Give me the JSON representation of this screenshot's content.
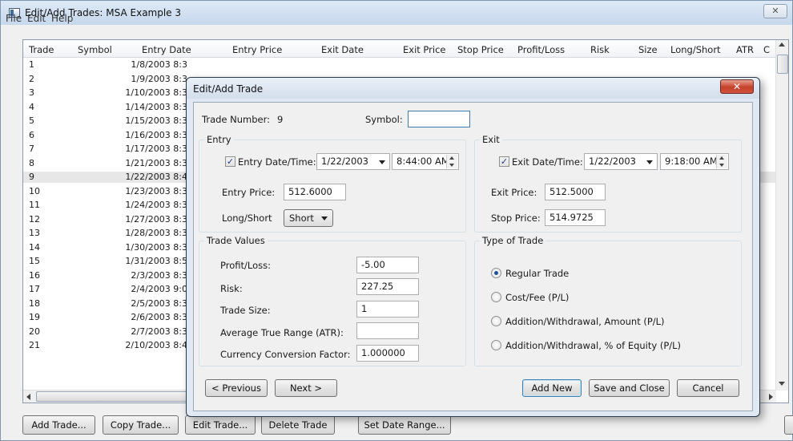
{
  "window": {
    "title": "Edit/Add Trades: MSA Example 3",
    "close_label": "✕"
  },
  "menu": [
    "File",
    "Edit",
    "Help"
  ],
  "table": {
    "columns": [
      "Trade",
      "Symbol",
      "Entry Date",
      "Entry Price",
      "Exit Date",
      "Exit Price",
      "Stop Price",
      "Profit/Loss",
      "Risk",
      "Size",
      "Long/Short",
      "ATR",
      "C"
    ],
    "rows": [
      {
        "trade": "1",
        "entry_date": "1/8/2003 8:3"
      },
      {
        "trade": "2",
        "entry_date": "1/9/2003 8:3"
      },
      {
        "trade": "3",
        "entry_date": "1/10/2003 8:3"
      },
      {
        "trade": "4",
        "entry_date": "1/14/2003 8:3"
      },
      {
        "trade": "5",
        "entry_date": "1/15/2003 8:3"
      },
      {
        "trade": "6",
        "entry_date": "1/16/2003 8:3"
      },
      {
        "trade": "7",
        "entry_date": "1/17/2003 8:3"
      },
      {
        "trade": "8",
        "entry_date": "1/21/2003 8:3"
      },
      {
        "trade": "9",
        "entry_date": "1/22/2003 8:4"
      },
      {
        "trade": "10",
        "entry_date": "1/23/2003 8:3"
      },
      {
        "trade": "11",
        "entry_date": "1/24/2003 8:3"
      },
      {
        "trade": "12",
        "entry_date": "1/27/2003 8:3"
      },
      {
        "trade": "13",
        "entry_date": "1/28/2003 8:3"
      },
      {
        "trade": "14",
        "entry_date": "1/30/2003 8:3"
      },
      {
        "trade": "15",
        "entry_date": "1/31/2003 8:5"
      },
      {
        "trade": "16",
        "entry_date": "2/3/2003 8:3"
      },
      {
        "trade": "17",
        "entry_date": "2/4/2003 9:0"
      },
      {
        "trade": "18",
        "entry_date": "2/5/2003 8:3"
      },
      {
        "trade": "19",
        "entry_date": "2/6/2003 8:3"
      },
      {
        "trade": "20",
        "entry_date": "2/7/2003 8:3"
      },
      {
        "trade": "21",
        "entry_date": "2/10/2003 8:4"
      }
    ],
    "selected_row": "9"
  },
  "bottom_buttons": [
    "Add Trade...",
    "Copy Trade...",
    "Edit Trade...",
    "Delete Trade",
    "Set Date Range..."
  ],
  "dialog": {
    "title": "Edit/Add Trade",
    "close_label": "✕",
    "trade_number_label": "Trade Number:",
    "trade_number": "9",
    "symbol_label": "Symbol:",
    "symbol_value": "",
    "entry": {
      "group_title": "Entry",
      "date_time_label": "Entry Date/Time:",
      "date": "1/22/2003",
      "time": "8:44:00 AM",
      "price_label": "Entry Price:",
      "price": "512.6000",
      "long_short_label": "Long/Short",
      "long_short_value": "Short"
    },
    "exit": {
      "group_title": "Exit",
      "date_time_label": "Exit Date/Time:",
      "date": "1/22/2003",
      "time": "9:18:00 AM",
      "price_label": "Exit Price:",
      "price": "512.5000",
      "stop_label": "Stop Price:",
      "stop": "514.9725"
    },
    "trade_values": {
      "group_title": "Trade Values",
      "profit_loss_label": "Profit/Loss:",
      "profit_loss": "-5.00",
      "risk_label": "Risk:",
      "risk": "227.25",
      "size_label": "Trade Size:",
      "size": "1",
      "atr_label": "Average True Range (ATR):",
      "atr": "",
      "ccf_label": "Currency Conversion Factor:",
      "ccf": "1.000000"
    },
    "type_of_trade": {
      "group_title": "Type of Trade",
      "options": [
        "Regular Trade",
        "Cost/Fee (P/L)",
        "Addition/Withdrawal, Amount (P/L)",
        "Addition/Withdrawal, % of Equity (P/L)"
      ],
      "selected": "Regular Trade"
    },
    "buttons": {
      "previous": "< Previous",
      "next": "Next >",
      "add_new": "Add New",
      "save_close": "Save and Close",
      "cancel": "Cancel"
    }
  }
}
